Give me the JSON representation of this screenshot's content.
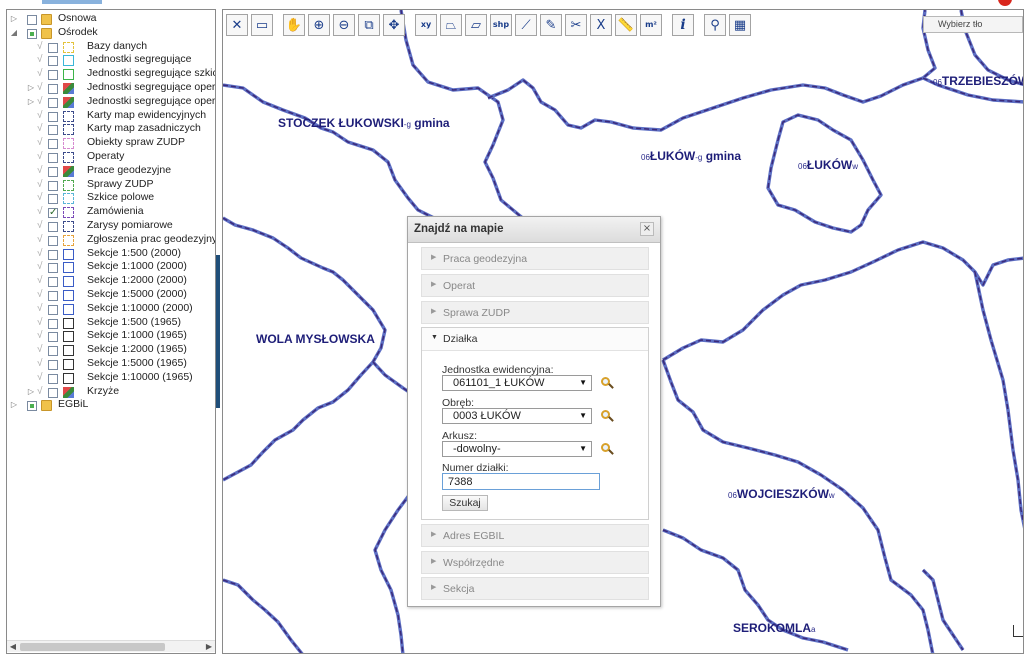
{
  "tree": {
    "items": [
      {
        "label": "Osnowa",
        "level": 0,
        "expander": "▷",
        "check": "",
        "cb": "none",
        "icon": "folder"
      },
      {
        "label": "Ośrodek",
        "level": 0,
        "expander": "◢",
        "check": "",
        "cb": "partial",
        "icon": "folder"
      },
      {
        "label": "Bazy danych",
        "level": 1,
        "expander": "",
        "check": "√",
        "cb": "none",
        "icon": "dash-yellow"
      },
      {
        "label": "Jednostki segregujące",
        "level": 1,
        "expander": "",
        "check": "√",
        "cb": "none",
        "icon": "sq-cyan"
      },
      {
        "label": "Jednostki segregujące szkiców",
        "level": 1,
        "expander": "",
        "check": "√",
        "cb": "none",
        "icon": "sq-green"
      },
      {
        "label": "Jednostki segregujące operat",
        "level": 1,
        "expander": "▷",
        "check": "√",
        "cb": "none",
        "icon": "multi"
      },
      {
        "label": "Jednostki segregujące operat",
        "level": 1,
        "expander": "▷",
        "check": "√",
        "cb": "none",
        "icon": "multi"
      },
      {
        "label": "Karty map ewidencyjnych",
        "level": 1,
        "expander": "",
        "check": "√",
        "cb": "none",
        "icon": "dash-navy"
      },
      {
        "label": "Karty map zasadniczych",
        "level": 1,
        "expander": "",
        "check": "√",
        "cb": "none",
        "icon": "dash-navy"
      },
      {
        "label": "Obiekty spraw ZUDP",
        "level": 1,
        "expander": "",
        "check": "√",
        "cb": "none",
        "icon": "dash-pink"
      },
      {
        "label": "Operaty",
        "level": 1,
        "expander": "",
        "check": "√",
        "cb": "none",
        "icon": "dash-navy"
      },
      {
        "label": "Prace geodezyjne",
        "level": 1,
        "expander": "",
        "check": "√",
        "cb": "none",
        "icon": "multi"
      },
      {
        "label": "Sprawy ZUDP",
        "level": 1,
        "expander": "",
        "check": "√",
        "cb": "none",
        "icon": "dash-green"
      },
      {
        "label": "Szkice polowe",
        "level": 1,
        "expander": "",
        "check": "√",
        "cb": "none",
        "icon": "dash-cyan"
      },
      {
        "label": "Zamówienia",
        "level": 1,
        "expander": "",
        "check": "√",
        "cb": "checked",
        "icon": "dash-purple"
      },
      {
        "label": "Zarysy pomiarowe",
        "level": 1,
        "expander": "",
        "check": "√",
        "cb": "none",
        "icon": "dash-navy"
      },
      {
        "label": "Zgłoszenia prac geodezyjnych",
        "level": 1,
        "expander": "",
        "check": "√",
        "cb": "none",
        "icon": "dash-orange"
      },
      {
        "label": "Sekcje 1:500 (2000)",
        "level": 1,
        "expander": "",
        "check": "√",
        "cb": "none",
        "icon": "sq-blue"
      },
      {
        "label": "Sekcje 1:1000 (2000)",
        "level": 1,
        "expander": "",
        "check": "√",
        "cb": "none",
        "icon": "sq-blue"
      },
      {
        "label": "Sekcje 1:2000 (2000)",
        "level": 1,
        "expander": "",
        "check": "√",
        "cb": "none",
        "icon": "sq-blue"
      },
      {
        "label": "Sekcje 1:5000 (2000)",
        "level": 1,
        "expander": "",
        "check": "√",
        "cb": "none",
        "icon": "sq-blue"
      },
      {
        "label": "Sekcje 1:10000 (2000)",
        "level": 1,
        "expander": "",
        "check": "√",
        "cb": "none",
        "icon": "sq-blue"
      },
      {
        "label": "Sekcje 1:500 (1965)",
        "level": 1,
        "expander": "",
        "check": "√",
        "cb": "none",
        "icon": "sq-dark"
      },
      {
        "label": "Sekcje 1:1000 (1965)",
        "level": 1,
        "expander": "",
        "check": "√",
        "cb": "none",
        "icon": "sq-dark"
      },
      {
        "label": "Sekcje 1:2000 (1965)",
        "level": 1,
        "expander": "",
        "check": "√",
        "cb": "none",
        "icon": "sq-dark"
      },
      {
        "label": "Sekcje 1:5000 (1965)",
        "level": 1,
        "expander": "",
        "check": "√",
        "cb": "none",
        "icon": "sq-dark"
      },
      {
        "label": "Sekcje 1:10000 (1965)",
        "level": 1,
        "expander": "",
        "check": "√",
        "cb": "none",
        "icon": "sq-dark"
      },
      {
        "label": "Krzyże",
        "level": 1,
        "expander": "▷",
        "check": "√",
        "cb": "none",
        "icon": "multi"
      },
      {
        "label": "EGBiL",
        "level": 0,
        "expander": "▷",
        "check": "",
        "cb": "partial",
        "icon": "folder"
      }
    ]
  },
  "toolbar": {
    "tools": [
      {
        "name": "clear-icon",
        "glyph": "✕"
      },
      {
        "name": "save-icon",
        "glyph": "▭"
      },
      {
        "name": "sep",
        "glyph": ""
      },
      {
        "name": "pan-hand-icon",
        "glyph": "✋"
      },
      {
        "name": "zoom-in-icon",
        "glyph": "⊕"
      },
      {
        "name": "zoom-out-icon",
        "glyph": "⊖"
      },
      {
        "name": "zoom-box-icon",
        "glyph": "⧉"
      },
      {
        "name": "full-extent-icon",
        "glyph": "✥"
      },
      {
        "name": "sep",
        "glyph": ""
      },
      {
        "name": "coordinates-xy-icon",
        "glyph": "xy"
      },
      {
        "name": "polygon-icon",
        "glyph": "⏢"
      },
      {
        "name": "rectangle-icon",
        "glyph": "▱"
      },
      {
        "name": "shp-icon",
        "glyph": "shp"
      },
      {
        "name": "polyline-icon",
        "glyph": "⟋"
      },
      {
        "name": "edit-pencil-icon",
        "glyph": "✎"
      },
      {
        "name": "cut-icon",
        "glyph": "✂"
      },
      {
        "name": "delete-x-icon",
        "glyph": "X"
      },
      {
        "name": "measure-length-icon",
        "glyph": "📏"
      },
      {
        "name": "measure-area-icon",
        "glyph": "m²"
      },
      {
        "name": "sep",
        "glyph": ""
      },
      {
        "name": "info-icon",
        "glyph": "i"
      },
      {
        "name": "sep",
        "glyph": ""
      },
      {
        "name": "pin-icon",
        "glyph": "⚲"
      },
      {
        "name": "grid-layer-icon",
        "glyph": "▦"
      }
    ]
  },
  "bg_select": {
    "value": "Wybierz tło"
  },
  "map": {
    "labels": [
      {
        "prefix": "",
        "text": "STOCZEK ŁUKOWSKI",
        "suffix": " gmina",
        "sup": "-g"
      },
      {
        "prefix": "06",
        "text": "ŁUKÓW",
        "suffix": " gmina",
        "sup": "-g"
      },
      {
        "prefix": "06",
        "text": "TRZEBIESZÓW",
        "suffix": "",
        "sup": ""
      },
      {
        "prefix": "06",
        "text": "ŁUKÓW",
        "suffix": "",
        "sup": "w"
      },
      {
        "prefix": "",
        "text": "WOLA MYSŁOWSKA",
        "suffix": "",
        "sup": ""
      },
      {
        "prefix": "06",
        "text": "WOJCIESZKÓW",
        "suffix": "",
        "sup": "w"
      },
      {
        "prefix": "",
        "text": "SEROKOMLA",
        "suffix": "",
        "sup": "a"
      }
    ]
  },
  "find_dialog": {
    "title": "Znajdź na mapie",
    "close_label": "×",
    "sections_before": [
      "Praca geodezyjna",
      "Operat",
      "Sprawa ZUDP"
    ],
    "open_section": "Działka",
    "sections_after": [
      "Adres EGBIL",
      "Współrzędne",
      "Sekcja"
    ],
    "fields": {
      "unit_label": "Jednostka ewidencyjna:",
      "unit_value": "061101_1 ŁUKÓW",
      "precinct_label": "Obręb:",
      "precinct_value": "0003 ŁUKÓW",
      "sheet_label": "Arkusz:",
      "sheet_value": "-dowolny-",
      "parcel_label": "Numer działki:",
      "parcel_value": "7388"
    },
    "search_button": "Szukaj"
  },
  "colors": {
    "boundary": "#5d6fc4",
    "boundary_dash": "#3b2a7a",
    "label": "#1e1e78",
    "splitter": "#1f4e79"
  }
}
